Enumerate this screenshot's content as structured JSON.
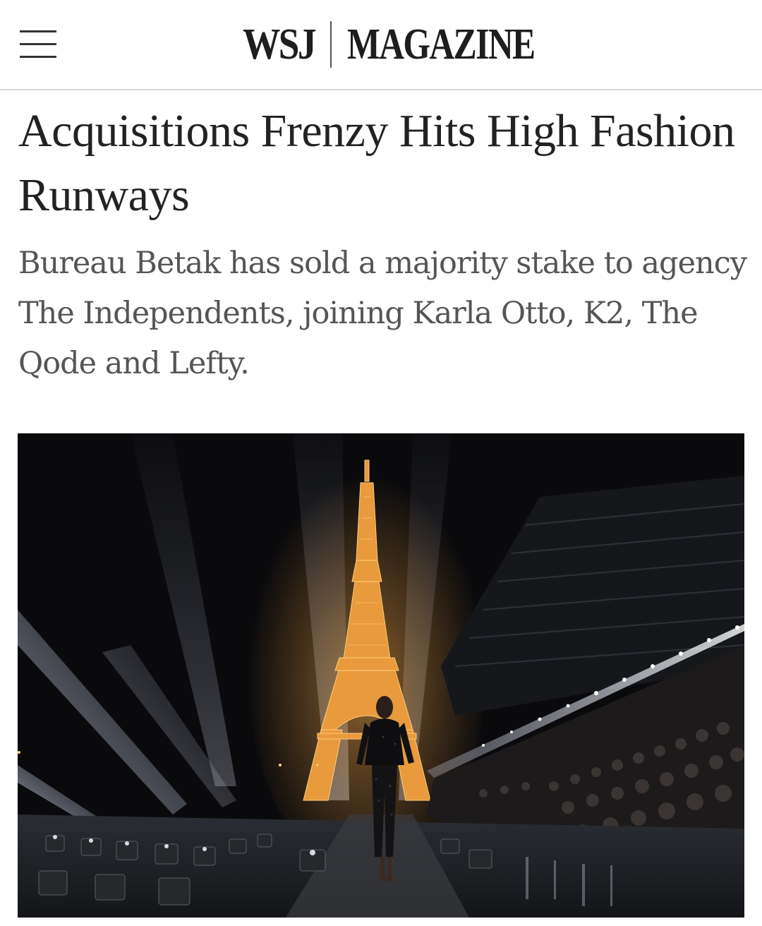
{
  "header": {
    "menu_label": "",
    "brand_left": "WSJ",
    "brand_right": "MAGAZINE"
  },
  "article": {
    "headline": "Acquisitions Frenzy Hits High Fashion Runways",
    "dek": "Bureau Betak has sold a majority stake to agency The Independents, joining Karla Otto, K2, The Qode and Lefty."
  },
  "hero_image": {
    "subject": "runway-show-eiffel-tower-night",
    "colors": {
      "sky": "#0b0b0d",
      "tower_glow": "#f0a040",
      "beam": "#c8d2e6"
    }
  },
  "icons": {
    "menu": "hamburger-menu-icon"
  }
}
